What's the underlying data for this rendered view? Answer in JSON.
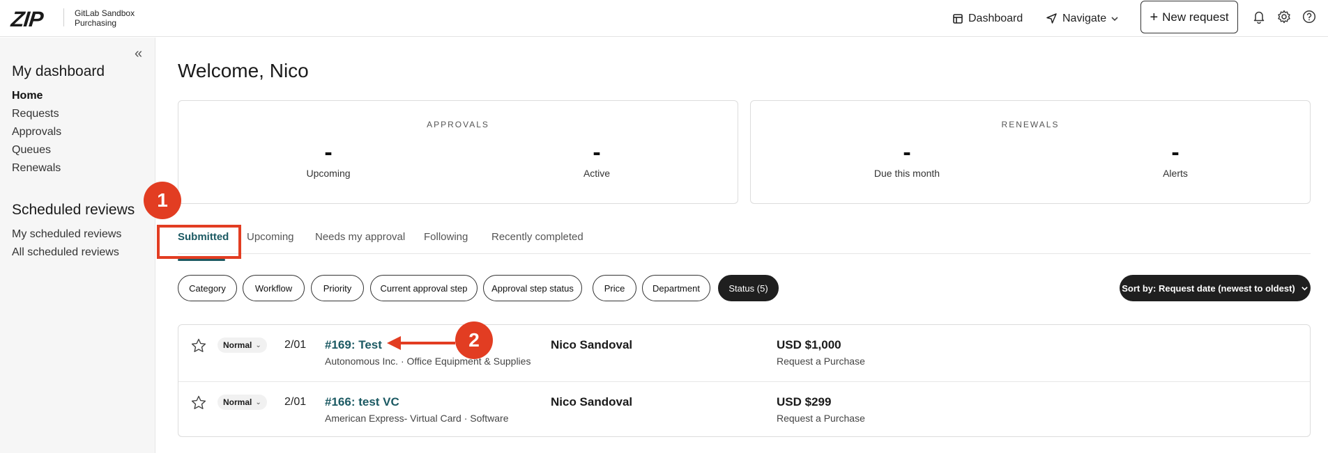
{
  "app": {
    "logo": "ZIP",
    "org_line1": "GitLab Sandbox",
    "org_line2": "Purchasing"
  },
  "topnav": {
    "dashboard": "Dashboard",
    "navigate": "Navigate",
    "new_request": "New request"
  },
  "sidebar": {
    "collapse": "«",
    "heading": "My dashboard",
    "items": [
      {
        "label": "Home"
      },
      {
        "label": "Requests"
      },
      {
        "label": "Approvals"
      },
      {
        "label": "Queues"
      },
      {
        "label": "Renewals"
      }
    ],
    "reviews_heading": "Scheduled reviews",
    "review_items": [
      {
        "label": "My scheduled reviews"
      },
      {
        "label": "All scheduled reviews"
      }
    ]
  },
  "main": {
    "welcome": "Welcome, Nico",
    "approvals_card": {
      "title": "APPROVALS",
      "metrics": [
        {
          "value": "-",
          "label": "Upcoming"
        },
        {
          "value": "-",
          "label": "Active"
        }
      ]
    },
    "renewals_card": {
      "title": "RENEWALS",
      "metrics": [
        {
          "value": "-",
          "label": "Due this month"
        },
        {
          "value": "-",
          "label": "Alerts"
        }
      ]
    },
    "tabs": [
      {
        "label": "Submitted"
      },
      {
        "label": "Upcoming"
      },
      {
        "label": "Needs my approval"
      },
      {
        "label": "Following"
      },
      {
        "label": "Recently completed"
      }
    ],
    "filters": [
      {
        "label": "Category"
      },
      {
        "label": "Workflow"
      },
      {
        "label": "Priority"
      },
      {
        "label": "Current approval step"
      },
      {
        "label": "Approval step status"
      },
      {
        "label": "Price"
      },
      {
        "label": "Department"
      },
      {
        "label": "Status (5)"
      }
    ],
    "sort_label": "Sort by: Request date (newest to oldest)",
    "requests": [
      {
        "priority": "Normal",
        "date": "2/01",
        "title": "#169: Test",
        "subtitle": "Autonomous Inc. · Office Equipment & Supplies",
        "requester": "Nico Sandoval",
        "amount": "USD $1,000",
        "amount_sub": "Request a Purchase"
      },
      {
        "priority": "Normal",
        "date": "2/01",
        "title": "#166: test VC",
        "subtitle": "American Express- Virtual Card · Software",
        "requester": "Nico Sandoval",
        "amount": "USD $299",
        "amount_sub": "Request a Purchase"
      }
    ]
  },
  "annotations": {
    "step1": "1",
    "step2": "2",
    "color": "#e23d22"
  }
}
